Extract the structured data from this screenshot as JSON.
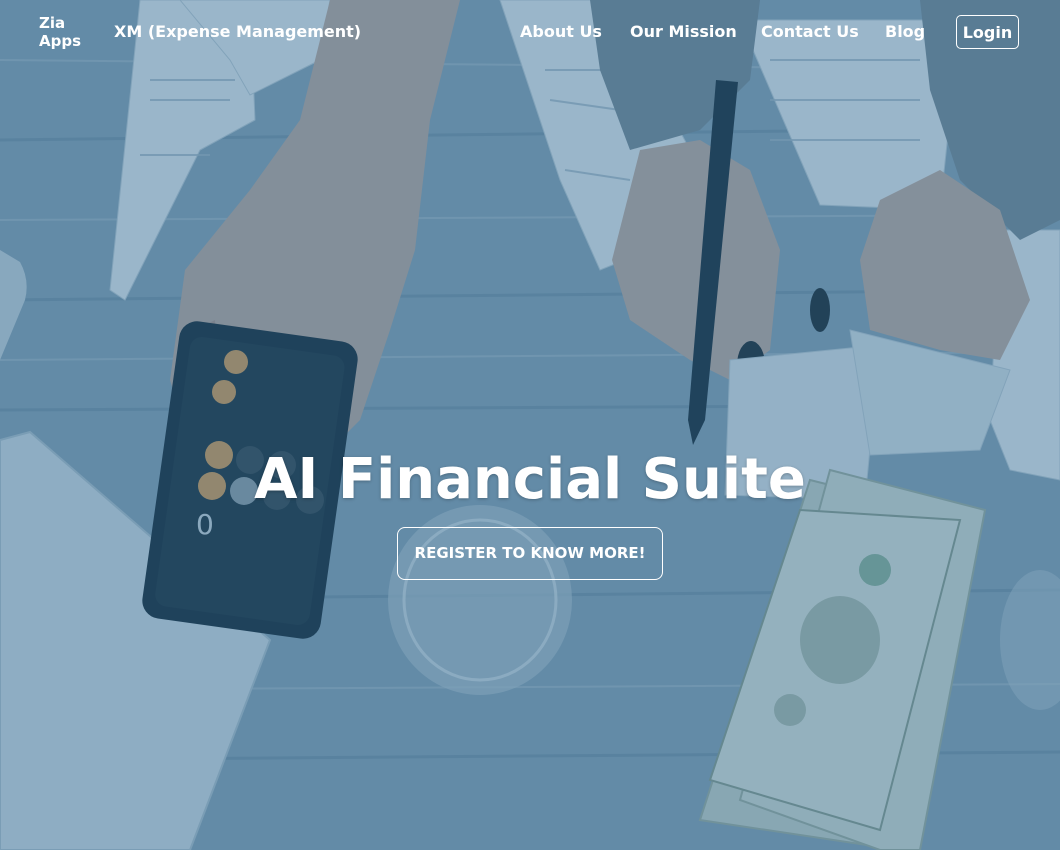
{
  "nav": {
    "brand": "Zia Apps",
    "links": [
      {
        "label": "XM (Expense Management)"
      },
      {
        "label": "About Us"
      },
      {
        "label": "Our Mission"
      },
      {
        "label": "Contact Us"
      },
      {
        "label": "Blog"
      }
    ],
    "login_label": "Login"
  },
  "hero": {
    "title": "AI Financial Suite",
    "cta_label": "REGISTER TO KNOW MORE!",
    "background_image": "desk-with-calculator-receipts-and-dollar-bills",
    "overlay_color": "#26628c"
  },
  "colors": {
    "text": "#ffffff",
    "overlay": "#26628c"
  }
}
